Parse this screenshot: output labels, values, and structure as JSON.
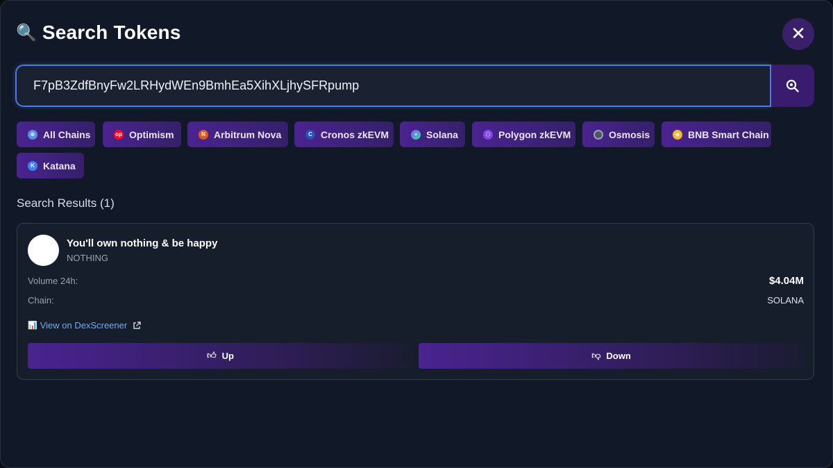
{
  "header": {
    "title_icon": "magnifier-icon",
    "title": "Search Tokens",
    "close_icon": "close-icon"
  },
  "search": {
    "value": "F7pB3ZdfBnyFw2LRHydWEn9BmhEa5XihXLjhySFRpump",
    "button_icon": "search-icon"
  },
  "chains": [
    {
      "label": "All Chains",
      "icon": "globe-icon",
      "color": "#5b8def"
    },
    {
      "label": "Optimism",
      "icon": "optimism-icon",
      "color": "#ff0420"
    },
    {
      "label": "Arbitrum Nova",
      "icon": "arbitrum-nova-icon",
      "color": "#e3571b"
    },
    {
      "label": "Cronos zkEVM",
      "icon": "cronos-icon",
      "color": "#2b4fb8"
    },
    {
      "label": "Solana",
      "icon": "solana-icon",
      "color": "#14f195"
    },
    {
      "label": "Polygon zkEVM",
      "icon": "polygon-icon",
      "color": "#8247e5"
    },
    {
      "label": "Osmosis",
      "icon": "osmosis-icon",
      "color": "#4a5568"
    },
    {
      "label": "BNB Smart Chain",
      "icon": "bnb-icon",
      "color": "#f3ba2f"
    },
    {
      "label": "Katana",
      "icon": "katana-icon",
      "color": "#3b82f6"
    }
  ],
  "results": {
    "heading": "Search Results (1)",
    "items": [
      {
        "name": "You'll own nothing & be happy",
        "symbol": "NOTHING",
        "volume_label": "Volume 24h:",
        "volume_value": "$4.04M",
        "chain_label": "Chain:",
        "chain_value": "SOLANA",
        "dex_link": "View on DexScreener",
        "up_label": "Up",
        "down_label": "Down"
      }
    ]
  },
  "colors": {
    "accent": "#4a2390",
    "link": "#7aa8f0",
    "focus_border": "#4f78e8"
  }
}
